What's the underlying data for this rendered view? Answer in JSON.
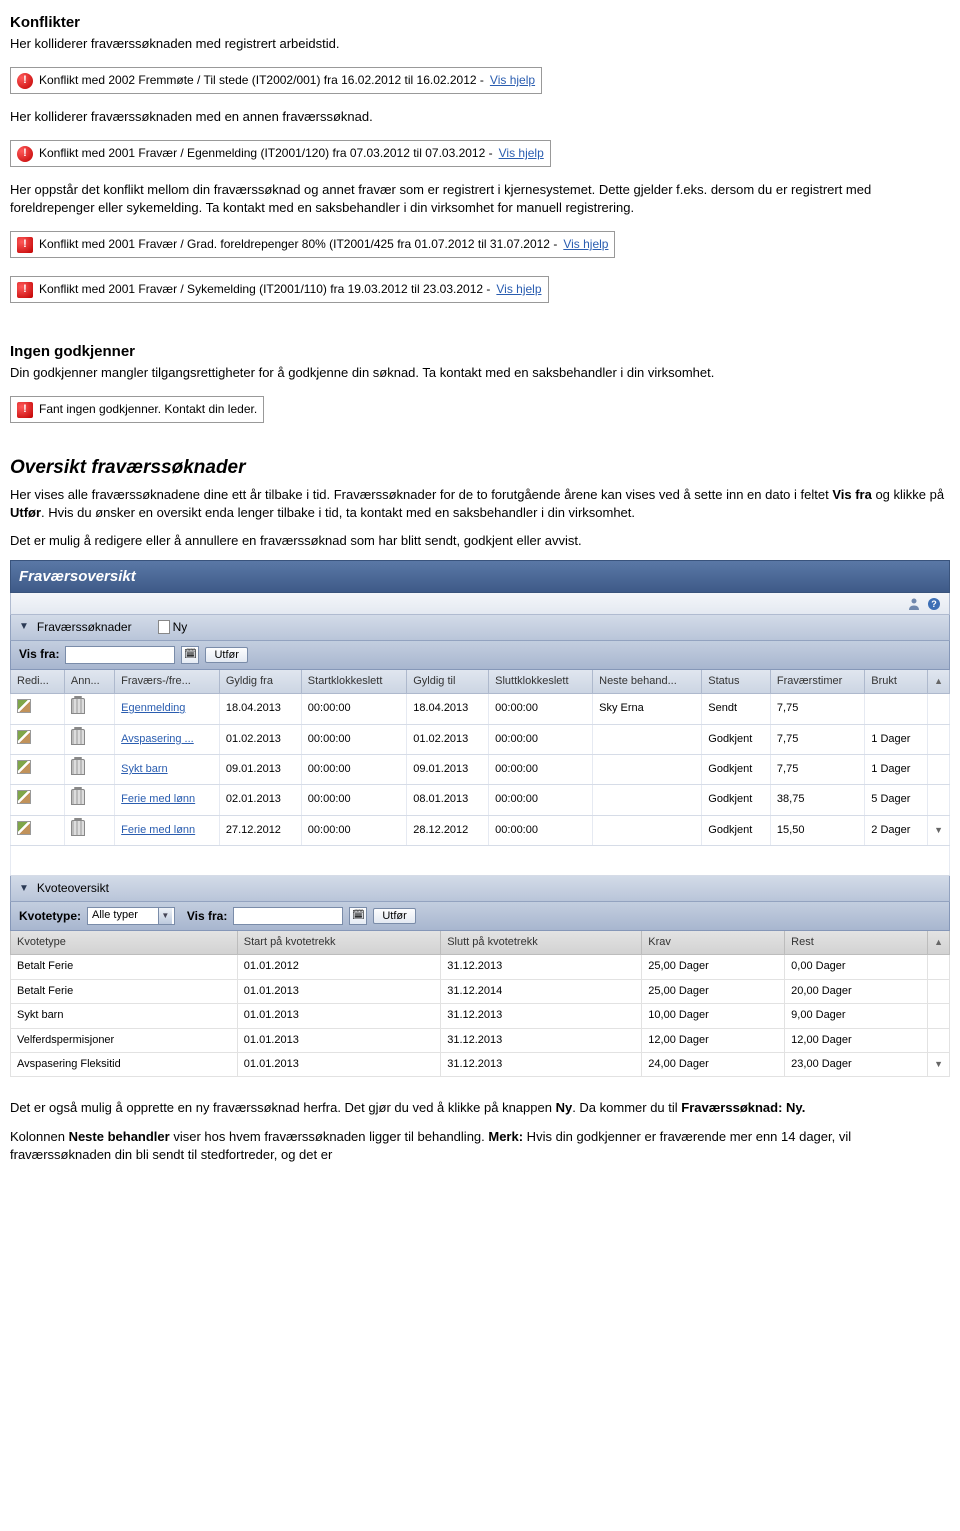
{
  "sections": {
    "konflikter_title": "Konflikter",
    "konflikter_p1": "Her kolliderer fraværssøknaden med registrert arbeidstid.",
    "konflikter_p2": "Her kolliderer fraværssøknaden med en annen fraværssøknad.",
    "konflikter_p3": "Her oppstår det konflikt mellom din fraværssøknad og annet fravær som er registrert i kjernesystemet. Dette gjelder f.eks. dersom du er registrert med foreldrepenger eller sykemelding. Ta kontakt med en saksbehandler i din virksomhet for manuell registrering.",
    "ingen_godkjenner_title": "Ingen godkjenner",
    "ingen_godkjenner_p": "Din godkjenner mangler tilgangsrettigheter for å godkjenne din søknad. Ta kontakt med en saksbehandler i din virksomhet.",
    "oversikt_title": "Oversikt fraværssøknader",
    "oversikt_p1_a": "Her vises alle fraværssøknadene dine ett år tilbake i tid. Fraværssøknader for de to forutgående årene kan vises ved å sette inn en dato i feltet ",
    "oversikt_p1_bold1": "Vis fra",
    "oversikt_p1_b": " og klikke på ",
    "oversikt_p1_bold2": "Utfør",
    "oversikt_p1_c": ". Hvis du ønsker en oversikt enda lenger tilbake i tid, ta kontakt med en saksbehandler i din virksomhet.",
    "oversikt_p2": "Det er mulig å redigere eller å annullere en fraværssøknad som har blitt sendt, godkjent eller avvist.",
    "bottom_p1_a": "Det er også mulig å opprette en ny fraværssøknad herfra.  Det gjør du ved å klikke på knappen ",
    "bottom_p1_bold": "Ny",
    "bottom_p1_b": ". Da kommer du til ",
    "bottom_p1_bold2": "Fraværssøknad: Ny.",
    "bottom_p2_a": "Kolonnen ",
    "bottom_p2_bold1": "Neste behandler",
    "bottom_p2_b": " viser hos hvem fraværssøknaden ligger til behandling. ",
    "bottom_p2_bold2": "Merk:",
    "bottom_p2_c": " Hvis din godkjenner er fraværende mer enn 14 dager, vil fraværssøknaden din bli sendt til stedfortreder, og det er"
  },
  "alerts": {
    "a1": "Konflikt med 2002 Fremmøte / Til stede (IT2002/001) fra 16.02.2012 til 16.02.2012 - ",
    "a2": "Konflikt med 2001 Fravær / Egenmelding (IT2001/120) fra 07.03.2012 til 07.03.2012 - ",
    "a3": "Konflikt med 2001 Fravær / Grad. foreldrepenger 80% (IT2001/425 fra 01.07.2012 til 31.07.2012 - ",
    "a4": "Konflikt med 2001 Fravær / Sykemelding (IT2001/110) fra 19.03.2012 til 23.03.2012 - ",
    "a5": "Fant ingen godkjenner. Kontakt din leder.",
    "vis_hjelp": "Vis hjelp"
  },
  "panel": {
    "title": "Fraværsoversikt",
    "sub1": "Fraværssøknader",
    "ny_label": "Ny",
    "vis_fra": "Vis fra:",
    "utfor": "Utfør",
    "sub2": "Kvoteoversikt",
    "kvotetype_label": "Kvotetype:",
    "kvotetype_value": "Alle typer"
  },
  "table1": {
    "cols": [
      "Redi...",
      "Ann...",
      "Fraværs-/fre...",
      "Gyldig fra",
      "Startklokkeslett",
      "Gyldig til",
      "Sluttklokkeslett",
      "Neste behand...",
      "Status",
      "Fraværstimer",
      "Brukt"
    ],
    "rows": [
      {
        "type": "Egenmelding",
        "from": "18.04.2013",
        "start": "00:00:00",
        "to": "18.04.2013",
        "end": "00:00:00",
        "next": "Sky Erna",
        "status": "Sendt",
        "hours": "7,75",
        "used": ""
      },
      {
        "type": "Avspasering ...",
        "from": "01.02.2013",
        "start": "00:00:00",
        "to": "01.02.2013",
        "end": "00:00:00",
        "next": "",
        "status": "Godkjent",
        "hours": "7,75",
        "used": "1 Dager"
      },
      {
        "type": "Sykt barn",
        "from": "09.01.2013",
        "start": "00:00:00",
        "to": "09.01.2013",
        "end": "00:00:00",
        "next": "",
        "status": "Godkjent",
        "hours": "7,75",
        "used": "1 Dager"
      },
      {
        "type": "Ferie med lønn",
        "from": "02.01.2013",
        "start": "00:00:00",
        "to": "08.01.2013",
        "end": "00:00:00",
        "next": "",
        "status": "Godkjent",
        "hours": "38,75",
        "used": "5 Dager"
      },
      {
        "type": "Ferie med lønn",
        "from": "27.12.2012",
        "start": "00:00:00",
        "to": "28.12.2012",
        "end": "00:00:00",
        "next": "",
        "status": "Godkjent",
        "hours": "15,50",
        "used": "2 Dager"
      }
    ]
  },
  "table2": {
    "cols": [
      "Kvotetype",
      "Start på kvotetrekk",
      "Slutt på kvotetrekk",
      "Krav",
      "Rest"
    ],
    "rows": [
      {
        "type": "Betalt Ferie",
        "start": "01.01.2012",
        "end": "31.12.2013",
        "krav": "25,00 Dager",
        "rest": "0,00 Dager"
      },
      {
        "type": "Betalt Ferie",
        "start": "01.01.2013",
        "end": "31.12.2014",
        "krav": "25,00 Dager",
        "rest": "20,00 Dager"
      },
      {
        "type": "Sykt barn",
        "start": "01.01.2013",
        "end": "31.12.2013",
        "krav": "10,00 Dager",
        "rest": "9,00 Dager"
      },
      {
        "type": "Velferdspermisjoner",
        "start": "01.01.2013",
        "end": "31.12.2013",
        "krav": "12,00 Dager",
        "rest": "12,00 Dager"
      },
      {
        "type": "Avspasering Fleksitid",
        "start": "01.01.2013",
        "end": "31.12.2013",
        "krav": "24,00 Dager",
        "rest": "23,00 Dager"
      }
    ]
  }
}
